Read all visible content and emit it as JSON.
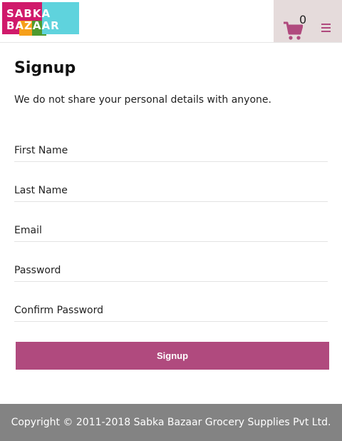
{
  "header": {
    "logo_line1": "SABKA",
    "logo_line2": "BAZAAR",
    "cart_count": "0",
    "cart_icon": "cart-icon",
    "menu_icon": "hamburger-menu-icon"
  },
  "main": {
    "title": "Signup",
    "subtitle": "We do not share your personal details with anyone."
  },
  "form": {
    "first_name_placeholder": "First Name",
    "last_name_placeholder": "Last Name",
    "email_placeholder": "Email",
    "password_placeholder": "Password",
    "confirm_password_placeholder": "Confirm Password",
    "submit_label": "Signup"
  },
  "footer": {
    "copyright": "Copyright © 2011-2018 Sabka Bazaar Grocery Supplies Pvt Ltd."
  },
  "colors": {
    "accent": "#b04a7e",
    "cart_bg": "#e5dbdb",
    "footer_bg": "#838383"
  }
}
